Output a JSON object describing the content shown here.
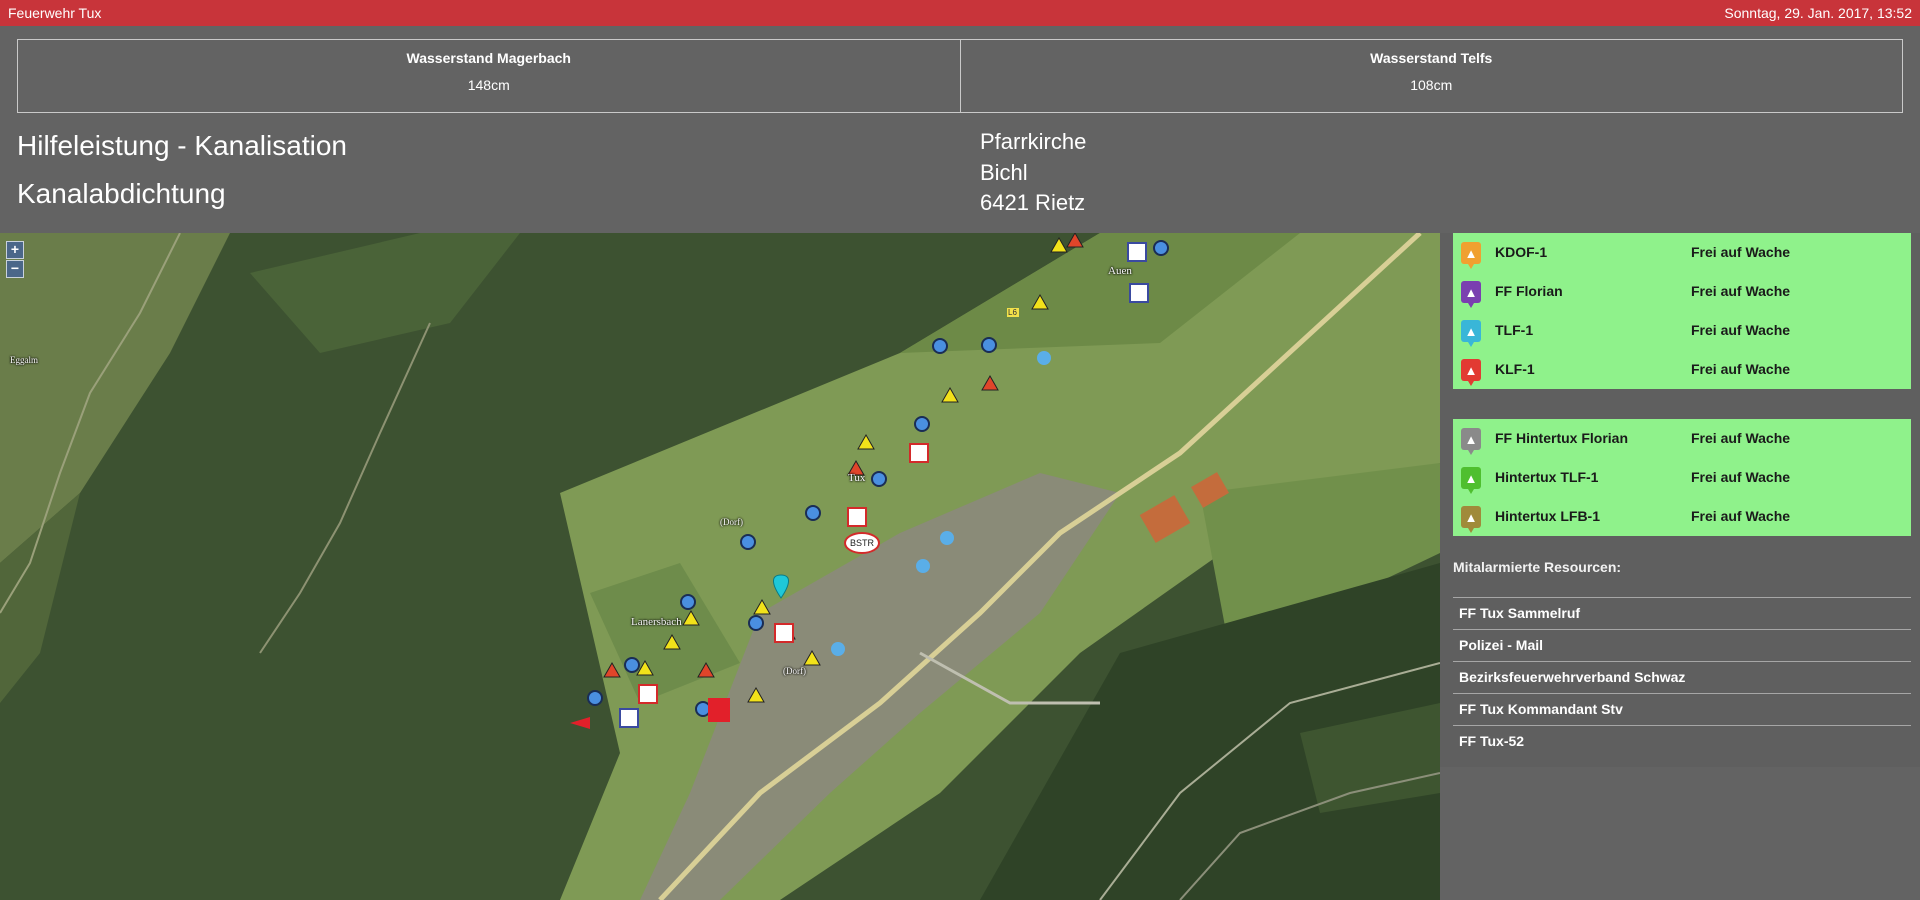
{
  "header": {
    "title": "Feuerwehr Tux",
    "datetime": "Sonntag, 29. Jan. 2017, 13:52"
  },
  "water_levels": [
    {
      "name": "Wasserstand Magerbach",
      "value": "148cm"
    },
    {
      "name": "Wasserstand Telfs",
      "value": "108cm"
    }
  ],
  "incident": {
    "type": "Hilfeleistung - Kanalisation",
    "keyword": "Kanalabdichtung",
    "address": [
      "Pfarrkirche",
      "Bichl",
      "6421 Rietz"
    ]
  },
  "map": {
    "zoom_in": "+",
    "zoom_out": "−",
    "labels": [
      "Eggalm",
      "Auen",
      "Tux",
      "(Dorf)",
      "Lanersbach",
      "(Dorf)",
      "L6",
      "BSTR"
    ]
  },
  "vehicles_primary": [
    {
      "name": "KDOF-1",
      "status": "Frei auf Wache",
      "color": "#f0a030",
      "icon": "car-icon"
    },
    {
      "name": "FF Florian",
      "status": "Frei auf Wache",
      "color": "#7a3fb0",
      "icon": "car-icon"
    },
    {
      "name": "TLF-1",
      "status": "Frei auf Wache",
      "color": "#39b6d8",
      "icon": "car-icon"
    },
    {
      "name": "KLF-1",
      "status": "Frei auf Wache",
      "color": "#e23a32",
      "icon": "car-icon"
    }
  ],
  "vehicles_secondary": [
    {
      "name": "FF Hintertux Florian",
      "status": "Frei auf Wache",
      "color": "#8a8a8a",
      "icon": "car-icon"
    },
    {
      "name": "Hintertux TLF-1",
      "status": "Frei auf Wache",
      "color": "#4fbf2f",
      "icon": "car-icon"
    },
    {
      "name": "Hintertux LFB-1",
      "status": "Frei auf Wache",
      "color": "#a08a3a",
      "icon": "car-icon"
    }
  ],
  "resources": {
    "title": "Mitalarmierte Resourcen:",
    "items": [
      "FF Tux Sammelruf",
      "Polizei - Mail",
      "Bezirksfeuerwehrverband Schwaz",
      "FF Tux Kommandant Stv",
      "FF Tux-52"
    ]
  },
  "colors": {
    "topbar": "#c8343a",
    "background": "#636363",
    "vehicle_row": "#8ff28b"
  }
}
